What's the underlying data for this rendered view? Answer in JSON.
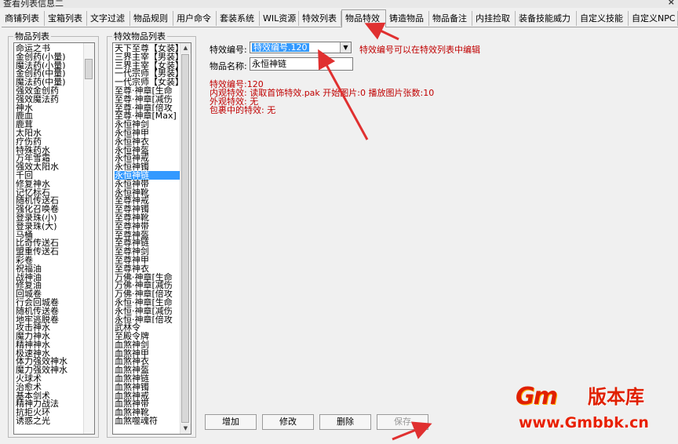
{
  "window": {
    "title": "查看列表信息二",
    "close_glyph": "×"
  },
  "tabs": [
    {
      "label": "商铺列表"
    },
    {
      "label": "宝箱列表"
    },
    {
      "label": "文字过滤"
    },
    {
      "label": "物品规则"
    },
    {
      "label": "用户命令"
    },
    {
      "label": "套装系统"
    },
    {
      "label": "WIL资源"
    },
    {
      "label": "特效列表"
    },
    {
      "label": "物品特效"
    },
    {
      "label": "铸造物品"
    },
    {
      "label": "物品备注"
    },
    {
      "label": "内挂捡取"
    },
    {
      "label": "装备技能威力"
    },
    {
      "label": "自定义技能"
    },
    {
      "label": "自定义NPC"
    }
  ],
  "item_list": {
    "title": "物品列表",
    "items": [
      "命运之书",
      "金创药(小量)",
      "魔法药(小量)",
      "金创药(中量)",
      "魔法药(中量)",
      "强效金创药",
      "强效魔法药",
      "神水",
      "鹿血",
      "鹿茸",
      "太阳水",
      "疗伤药",
      "特殊药水",
      "万年雪霜",
      "强效太阳水",
      "千回",
      "修复神水",
      "记忆标石",
      "随机传送石",
      "强化召唤卷",
      "登录珠(小)",
      "登录珠(大)",
      "马桶",
      "比奇传送石",
      "盟重传送石",
      "彩卷",
      "祝福油",
      "战神油",
      "修复油",
      "回城卷",
      "行会回城卷",
      "随机传送卷",
      "地牢逃脱卷",
      "攻击神水",
      "魔力神水",
      "精神神水",
      "极速神水",
      "体力强效神水",
      "魔力强效神水",
      "火球术",
      "治愈术",
      "基本剑术",
      "精神力战法",
      "抗拒火环",
      "诱惑之光"
    ]
  },
  "effect_list": {
    "title": "特效物品列表",
    "items": [
      "天下至尊【女装】",
      "三界主宰【男装】",
      "三界主宰【女装】",
      "一代宗师【男装】",
      "一代宗师【女装】",
      "至尊·神章[生命",
      "至尊·神章[减伤",
      "至尊·神章[倍攻",
      "至尊·神章[Max]",
      "永恒神剑",
      "永恒神甲",
      "永恒神衣",
      "永恒神盔",
      "永恒神戒",
      "永恒神镯",
      "永恒神链",
      "永恒神带",
      "永恒神靴",
      "至尊神戒",
      "至尊神镯",
      "至尊神靴",
      "至尊神带",
      "至尊神盔",
      "至尊神链",
      "至尊神剑",
      "至尊神甲",
      "至尊神衣",
      "万佛·神章[生命",
      "万佛·神章[减伤",
      "万佛·神章[倍攻",
      "永恒·神章[生命",
      "永恒·神章[减伤",
      "永恒·神章[倍攻",
      "武林令",
      "至殿令牌",
      "血煞神剑",
      "血煞神甲",
      "血煞神衣",
      "血煞神盔",
      "血煞神链",
      "血煞神镯",
      "血煞神戒",
      "血煞神带",
      "血煞神靴",
      "血煞噬魂符"
    ],
    "selected_index": 15
  },
  "form": {
    "effect_no_label": "特效编号:",
    "effect_no_value": "特效编号.120",
    "hint": "特效编号可以在特效列表中编辑",
    "item_name_label": "物品名称:",
    "item_name_value": "永恒神链"
  },
  "info": {
    "line1": "特效编号:120",
    "line2": "内观特效: 读取首饰特效.pak 开始图片:0 播放图片张数:10",
    "line3": "外观特效: 无",
    "line4": "包裹中的特效: 无"
  },
  "buttons": {
    "add": "增加",
    "modify": "修改",
    "delete": "删除",
    "save": "保存"
  },
  "watermark": {
    "logo_text": "Gm",
    "site_name": "版本库",
    "url": "www.Gmbbk.cn"
  },
  "colors": {
    "selection": "#3399ff",
    "info_red": "#c00000",
    "arrow_red": "#e03030"
  }
}
